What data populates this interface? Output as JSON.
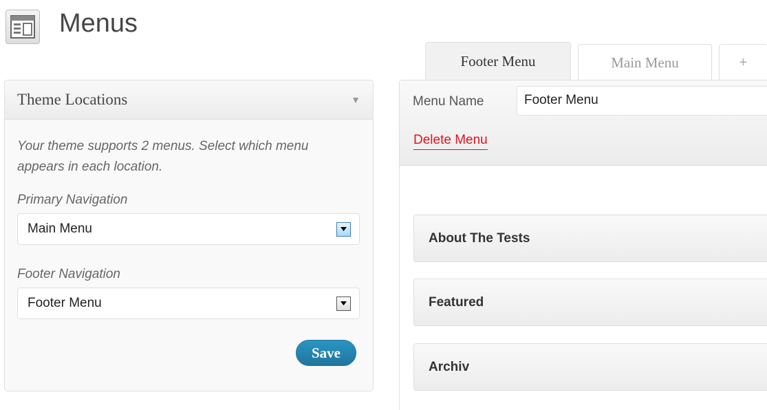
{
  "header": {
    "title": "Menus",
    "icon": "menus-icon"
  },
  "tabs": [
    {
      "label": "Footer Menu",
      "active": true
    },
    {
      "label": "Main Menu",
      "active": false
    },
    {
      "label": "+",
      "active": false
    }
  ],
  "theme_locations": {
    "title": "Theme Locations",
    "description": "Your theme supports 2 menus. Select which menu appears in each location.",
    "primary_label": "Primary Navigation",
    "primary_value": "Main Menu",
    "footer_label": "Footer Navigation",
    "footer_value": "Footer Menu",
    "save_label": "Save"
  },
  "menu_editor": {
    "name_label": "Menu Name",
    "name_value": "Footer Menu",
    "delete_label": "Delete Menu",
    "items": [
      "About The Tests",
      "Featured",
      "Archiv"
    ]
  },
  "colors": {
    "accent": "#21759b",
    "delete": "#e3141b"
  }
}
